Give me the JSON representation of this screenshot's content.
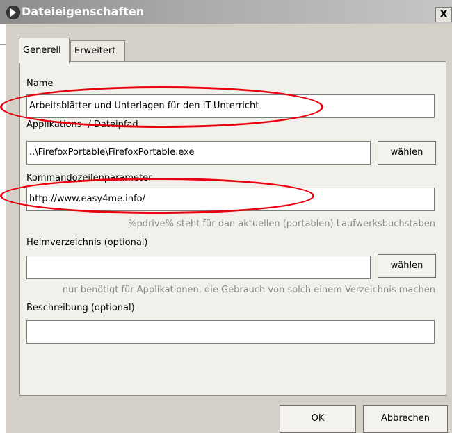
{
  "window": {
    "title": "Dateieigenschaften",
    "close_label": "X"
  },
  "tabs": [
    {
      "label": "Generell",
      "active": true
    },
    {
      "label": "Erweitert",
      "active": false
    }
  ],
  "form": {
    "name": {
      "label": "Name",
      "value": "Arbeitsblätter und Unterlagen für den IT-Unterricht"
    },
    "path": {
      "label": "Applikations- / Dateipfad",
      "value": "..\\FirefoxPortable\\FirefoxPortable.exe",
      "button": "wählen"
    },
    "cmdline": {
      "label": "Kommandozeilenparameter",
      "value": "http://www.easy4me.info/",
      "hint": "%pdrive% steht für dan aktuellen (portablen) Laufwerksbuchstaben"
    },
    "home": {
      "label": "Heimverzeichnis (optional)",
      "value": "",
      "button": "wählen",
      "hint": "nur benötigt für Applikationen, die Gebrauch von solch einem Verzeichnis machen"
    },
    "description": {
      "label": "Beschreibung (optional)",
      "value": ""
    }
  },
  "buttons": {
    "ok": "OK",
    "cancel": "Abbrechen"
  },
  "colors": {
    "highlight": "#e8000f",
    "dialog_bg": "#d4d0c8"
  }
}
